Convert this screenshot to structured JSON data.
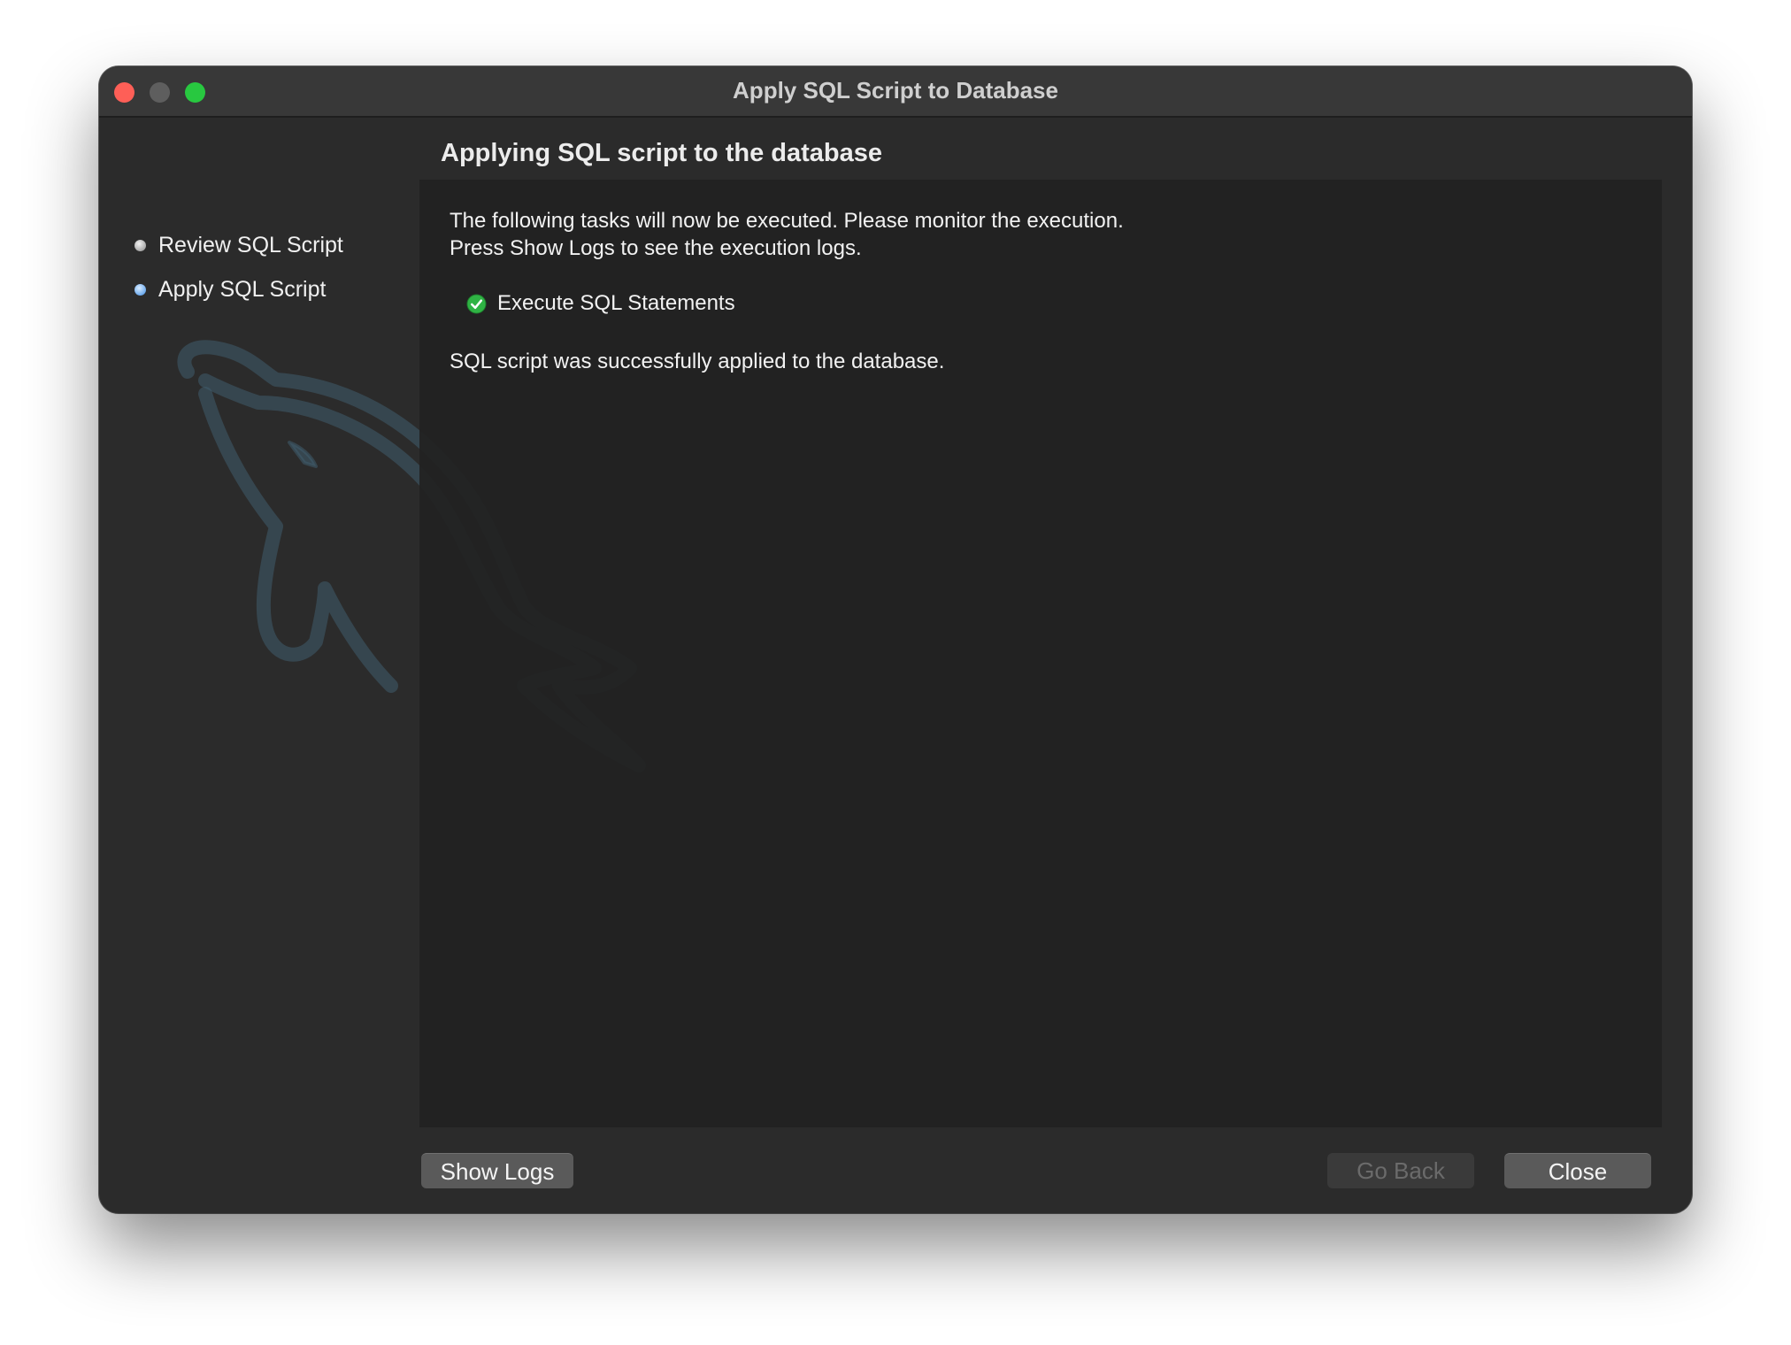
{
  "window": {
    "title": "Apply SQL Script to Database"
  },
  "sidebar": {
    "steps": [
      {
        "label": "Review SQL Script",
        "state": "done"
      },
      {
        "label": "Apply SQL Script",
        "state": "current"
      }
    ]
  },
  "main": {
    "heading": "Applying SQL script to the database",
    "intro_line1": "The following tasks will now be executed. Please monitor the execution.",
    "intro_line2": "Press Show Logs to see the execution logs.",
    "tasks": [
      {
        "label": "Execute SQL Statements",
        "status": "success",
        "icon": "check-circle-icon"
      }
    ],
    "result": "SQL script was successfully applied to the database."
  },
  "buttons": {
    "show_logs": "Show Logs",
    "go_back": "Go Back",
    "close": "Close"
  },
  "colors": {
    "close_light": "#fe5f57",
    "minimize_light": "#5e5e5e",
    "maximize_light": "#28c840",
    "success": "#2fb344",
    "current_step": "#3f8ee6"
  }
}
